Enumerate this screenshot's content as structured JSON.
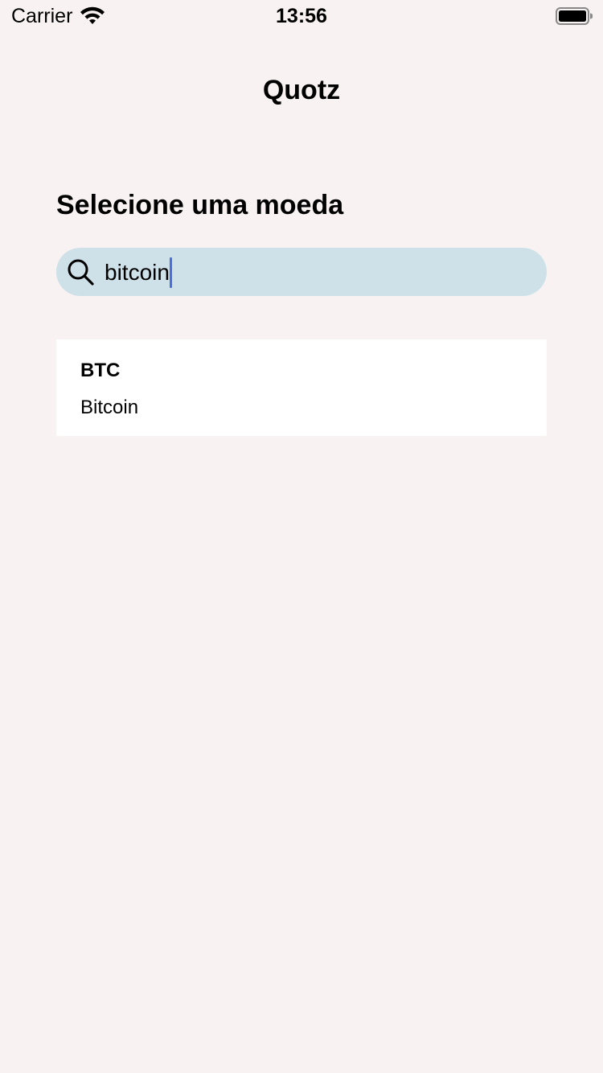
{
  "status_bar": {
    "carrier": "Carrier",
    "time": "13:56",
    "wifi_icon": "wifi-icon",
    "battery_icon": "battery-full-icon"
  },
  "header": {
    "title": "Quotz"
  },
  "main": {
    "section_title": "Selecione uma moeda",
    "search": {
      "icon": "search-icon",
      "value": "bitcoin",
      "placeholder": ""
    },
    "results": [
      {
        "code": "BTC",
        "name": "Bitcoin"
      }
    ]
  },
  "colors": {
    "background": "#f8f2f2",
    "search_background": "#cfe1e8",
    "caret": "#4a6ee0",
    "card_background": "#ffffff"
  }
}
